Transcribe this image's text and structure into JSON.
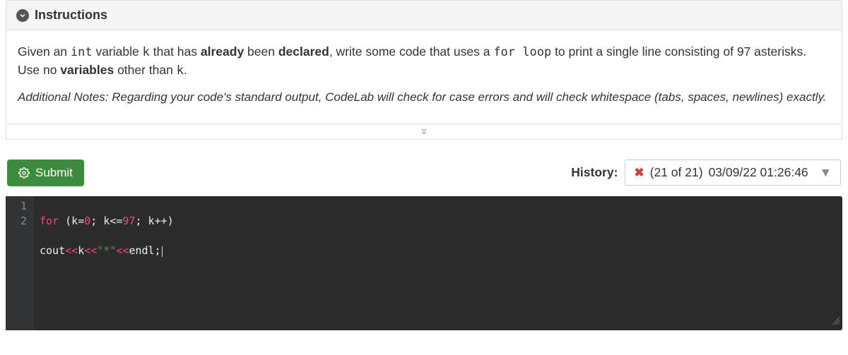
{
  "panel": {
    "title": "Instructions"
  },
  "instructions": {
    "t1": "Given an ",
    "t2": "int",
    "t3": " variable ",
    "t4": "k",
    "t5": " that has ",
    "t6": "already",
    "t7": " been ",
    "t8": "declared",
    "t9": ", write some code that uses a ",
    "t10": "for loop",
    "t11": " to print a single line consisting of 97 asterisks. Use no ",
    "t12": "variables",
    "t13": " other than ",
    "t14": "k",
    "t15": "."
  },
  "notes": "Additional Notes: Regarding your code's standard output, CodeLab will check for case errors and will check whitespace (tabs, spaces, newlines) exactly.",
  "actions": {
    "submit_label": "Submit",
    "history_label": "History:",
    "history_count": "(21 of 21)",
    "history_timestamp": "03/09/22 01:26:46"
  },
  "editor": {
    "lines": [
      {
        "n": "1"
      },
      {
        "n": "2"
      }
    ],
    "l1": {
      "for": "for",
      "open": " (",
      "a1": "k",
      "eq1": "=",
      "z": "0",
      "sc1": "; ",
      "a2": "k",
      "le": "<=",
      "nn": "97",
      "sc2": "; ",
      "a3": "k",
      "pp": "++",
      "close": ")"
    },
    "l2": {
      "cout": "cout",
      "op1": "<<",
      "kv": "k",
      "op2": "<<",
      "str": "\"*\"",
      "op3": "<<",
      "endl": "endl",
      "semi": ";"
    }
  }
}
